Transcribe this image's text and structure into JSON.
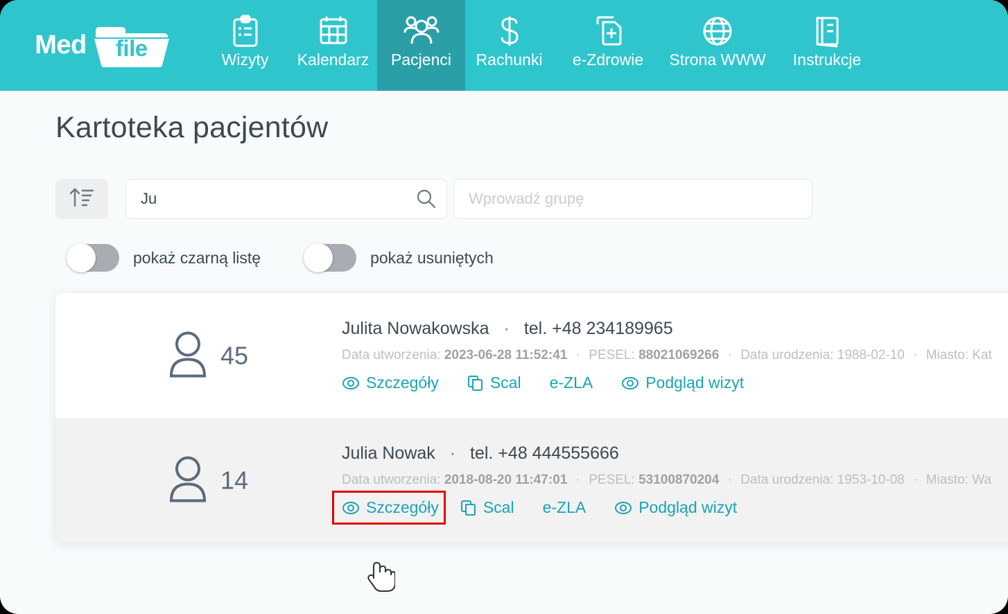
{
  "brand": {
    "name_prefix": "Med",
    "name_badge": "file"
  },
  "nav": [
    {
      "label": "Wizyty",
      "icon": "clipboard-icon",
      "active": false
    },
    {
      "label": "Kalendarz",
      "icon": "calendar-icon",
      "active": false
    },
    {
      "label": "Pacjenci",
      "icon": "people-icon",
      "active": true
    },
    {
      "label": "Rachunki",
      "icon": "dollar-icon",
      "active": false
    },
    {
      "label": "e-Zdrowie",
      "icon": "medical-documents-icon",
      "active": false
    },
    {
      "label": "Strona WWW",
      "icon": "globe-icon",
      "active": false
    },
    {
      "label": "Instrukcje",
      "icon": "book-icon",
      "active": false
    }
  ],
  "page": {
    "title": "Kartoteka pacjentów"
  },
  "controls": {
    "sort_icon": "sort-ascending-icon",
    "search_value": "Ju",
    "search_placeholder": "",
    "search_icon": "search-icon",
    "group_value": "",
    "group_placeholder": "Wprowadź grupę"
  },
  "toggles": [
    {
      "label": "pokaż czarną listę",
      "on": false
    },
    {
      "label": "pokaż usuniętych",
      "on": false
    }
  ],
  "labels": {
    "created": "Data utworzenia:",
    "pesel": "PESEL:",
    "birth": "Data urodzenia:",
    "city": "Miasto:"
  },
  "actions": {
    "details": "Szczegóły",
    "merge": "Scal",
    "ezla": "e-ZLA",
    "visits": "Podgląd wizyt"
  },
  "patients": [
    {
      "count": "45",
      "name": "Julita Nowakowska",
      "separator": "·",
      "phone": "tel. +48 234189965",
      "created": "2023-06-28 11:52:41",
      "pesel": "88021069266",
      "birth": "1988-02-10",
      "city": "Kat",
      "highlighted": false
    },
    {
      "count": "14",
      "name": "Julia Nowak",
      "separator": "·",
      "phone": "tel. +48 444555666",
      "created": "2018-08-20 11:47:01",
      "pesel": "53100870204",
      "birth": "1953-10-08",
      "city": "Wa",
      "highlighted": true
    }
  ],
  "colors": {
    "header_teal": "#2fc5cd",
    "active_tab_teal": "#2a9fa8",
    "link_teal": "#1aa3b5",
    "highlight_red": "#e60000",
    "page_bg": "#f7fbfc"
  }
}
